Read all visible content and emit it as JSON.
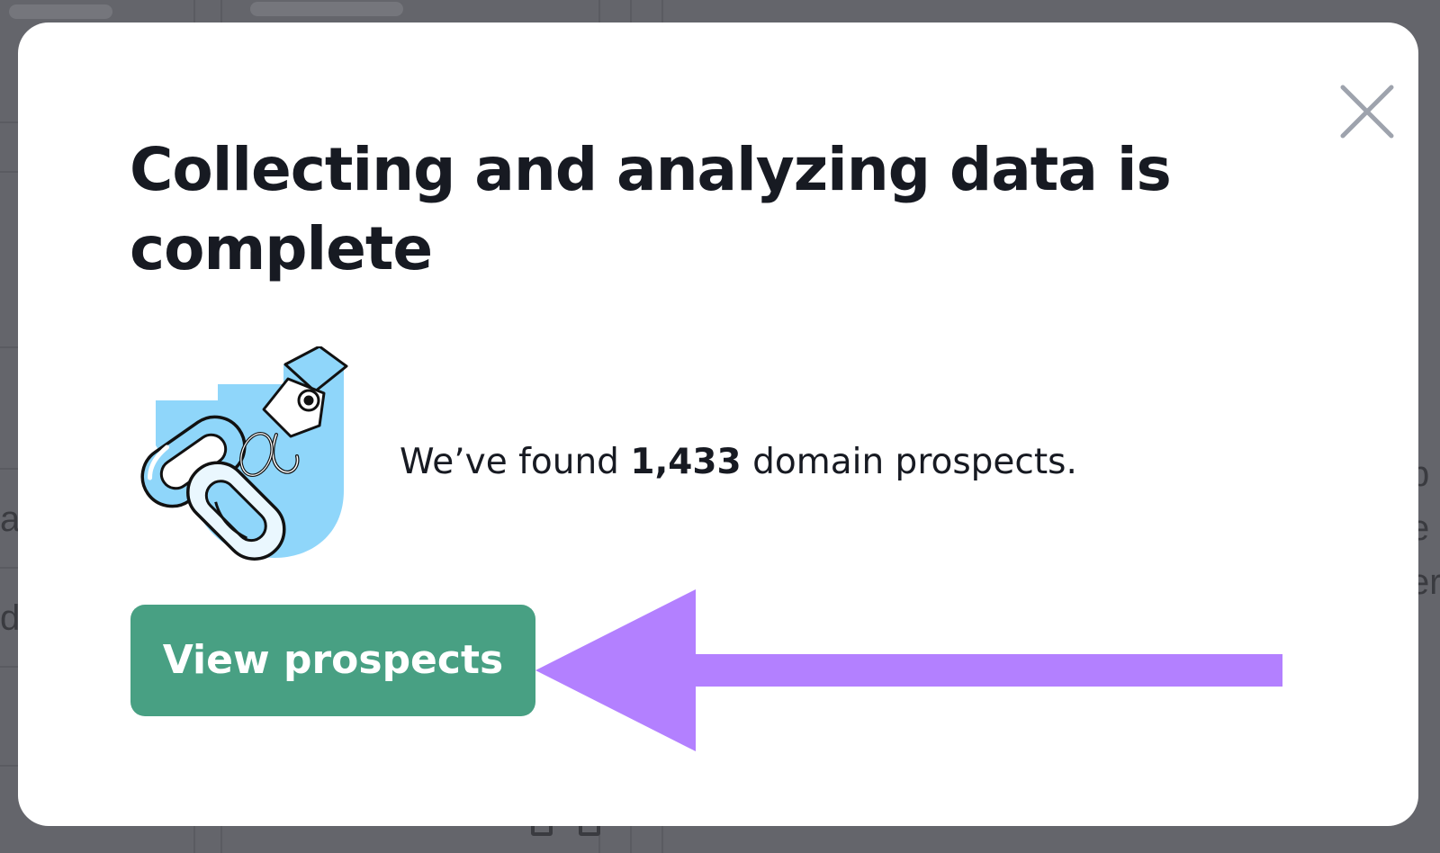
{
  "dialog": {
    "title": "Collecting and analyzing data is complete",
    "message": {
      "prefix": "We’ve found ",
      "count": "1,433",
      "suffix": " domain prospects."
    },
    "primary_button_label": "View prospects",
    "close_icon": "close-icon",
    "illustration_icon": "chain-link-hook-icon"
  },
  "annotation": {
    "arrow_icon": "arrow-left-icon",
    "arrow_color": "#b380ff"
  },
  "background": {
    "peek_letters_left": [
      "a",
      "d"
    ],
    "peek_letters_right": [
      "b",
      "e",
      "er"
    ]
  },
  "colors": {
    "button": "#48a083",
    "illustration_blue": "#8fd6fa",
    "overlay": "#64656b",
    "title": "#171a22"
  }
}
